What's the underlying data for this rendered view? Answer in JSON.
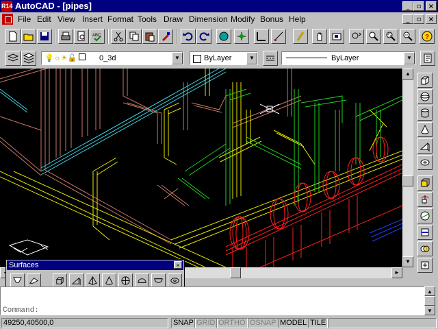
{
  "window": {
    "title": "AutoCAD - [pipes]",
    "app_icon_text": "R14"
  },
  "menu": [
    "File",
    "Edit",
    "View",
    "Insert",
    "Format",
    "Tools",
    "Draw",
    "Dimension",
    "Modify",
    "Bonus",
    "Help"
  ],
  "properties": {
    "layer": "0_3d",
    "color": "ByLayer",
    "linetype": "ByLayer"
  },
  "surfaces": {
    "title": "Surfaces"
  },
  "command": {
    "lines": [
      "",
      "",
      "Command:"
    ]
  },
  "status": {
    "coords": "49250,40500,0",
    "toggles": [
      {
        "label": "SNAP",
        "active": true
      },
      {
        "label": "GRID",
        "active": false
      },
      {
        "label": "ORTHO",
        "active": false
      },
      {
        "label": "OSNAP",
        "active": false
      },
      {
        "label": "MODEL",
        "active": true
      },
      {
        "label": "TILE",
        "active": true
      }
    ]
  },
  "colors": {
    "titlebar": "#000080",
    "desktop": "#c0c0c0",
    "drawing_bg": "#000000"
  }
}
